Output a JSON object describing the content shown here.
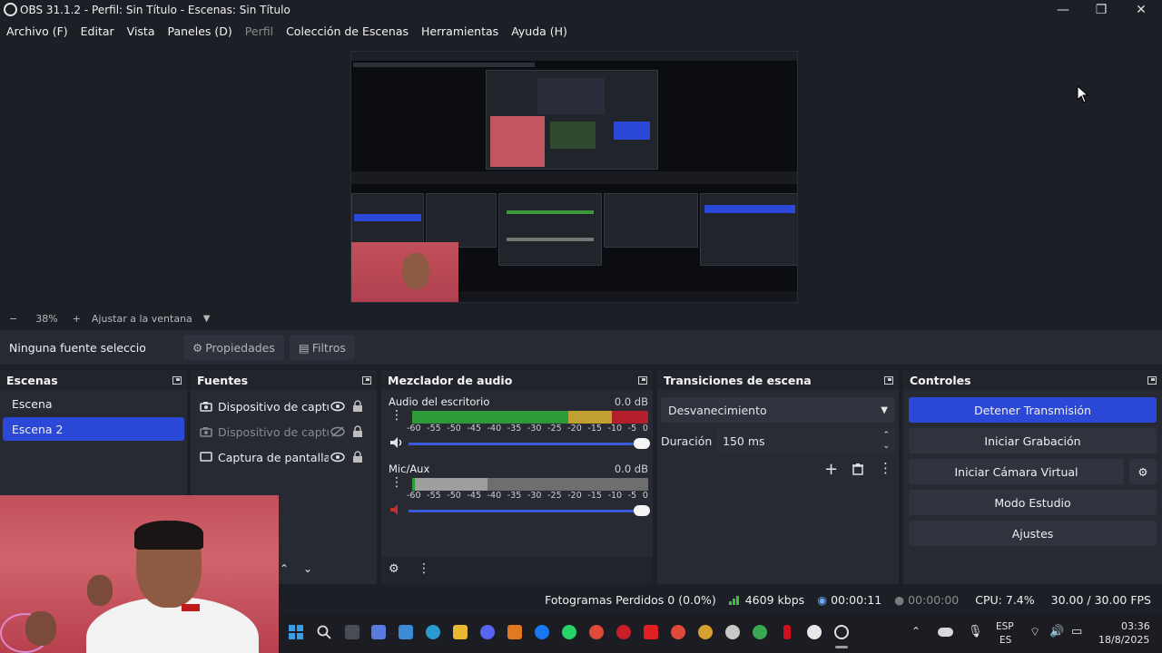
{
  "window": {
    "title": "OBS 31.1.2 - Perfil: Sin Título - Escenas: Sin Título"
  },
  "menu": [
    {
      "label": "Archivo (F)",
      "disabled": false
    },
    {
      "label": "Editar",
      "disabled": false
    },
    {
      "label": "Vista",
      "disabled": false
    },
    {
      "label": "Paneles (D)",
      "disabled": false
    },
    {
      "label": "Perfil",
      "disabled": true
    },
    {
      "label": "Colección de Escenas",
      "disabled": false
    },
    {
      "label": "Herramientas",
      "disabled": false
    },
    {
      "label": "Ayuda (H)",
      "disabled": false
    }
  ],
  "zoom": {
    "minus": "−",
    "value": "38%",
    "plus": "+",
    "fit_label": "Ajustar a la ventana"
  },
  "source_toolbar": {
    "no_source": "Ninguna fuente seleccionada",
    "properties": "Propiedades",
    "filters": "Filtros"
  },
  "scenes": {
    "title": "Escenas",
    "items": [
      "Escena",
      "Escena 2"
    ],
    "active_index": 1
  },
  "sources": {
    "title": "Fuentes",
    "items": [
      {
        "name": "Dispositivo de captura",
        "visible": true,
        "icon": "camera-icon"
      },
      {
        "name": "Dispositivo de captura",
        "visible": false,
        "icon": "camera-icon"
      },
      {
        "name": "Captura de pantalla",
        "visible": true,
        "icon": "monitor-icon"
      }
    ]
  },
  "mixer": {
    "title": "Mezclador de audio",
    "scale": [
      "-60",
      "-55",
      "-50",
      "-45",
      "-40",
      "-35",
      "-30",
      "-25",
      "-20",
      "-15",
      "-10",
      "-5",
      "0"
    ],
    "tracks": [
      {
        "name": "Audio del escritorio",
        "db": "0.0 dB",
        "level": 1.0,
        "muted": false
      },
      {
        "name": "Mic/Aux",
        "db": "0.0 dB",
        "level": 1.0,
        "muted": true
      }
    ]
  },
  "transitions": {
    "title": "Transiciones de escena",
    "selected": "Desvanecimiento",
    "duration_label": "Duración",
    "duration_value": "150 ms"
  },
  "controls": {
    "title": "Controles",
    "buttons": [
      "Detener Transmisión",
      "Iniciar Grabación",
      "Iniciar Cámara Virtual",
      "Modo Estudio",
      "Ajustes"
    ]
  },
  "status": {
    "dropped_frames": "Fotogramas Perdidos 0 (0.0%)",
    "bitrate": "4609 kbps",
    "stream_time": "00:00:11",
    "record_time": "00:00:00",
    "cpu": "CPU: 7.4%",
    "fps": "30.00 / 30.00 FPS"
  },
  "taskbar": {
    "lang_top": "ESP",
    "lang_bottom": "ES",
    "time": "03:36",
    "date": "18/8/2025"
  },
  "colors": {
    "accent": "#2c48d6",
    "panel": "#272a33",
    "background": "#1d1f26"
  }
}
